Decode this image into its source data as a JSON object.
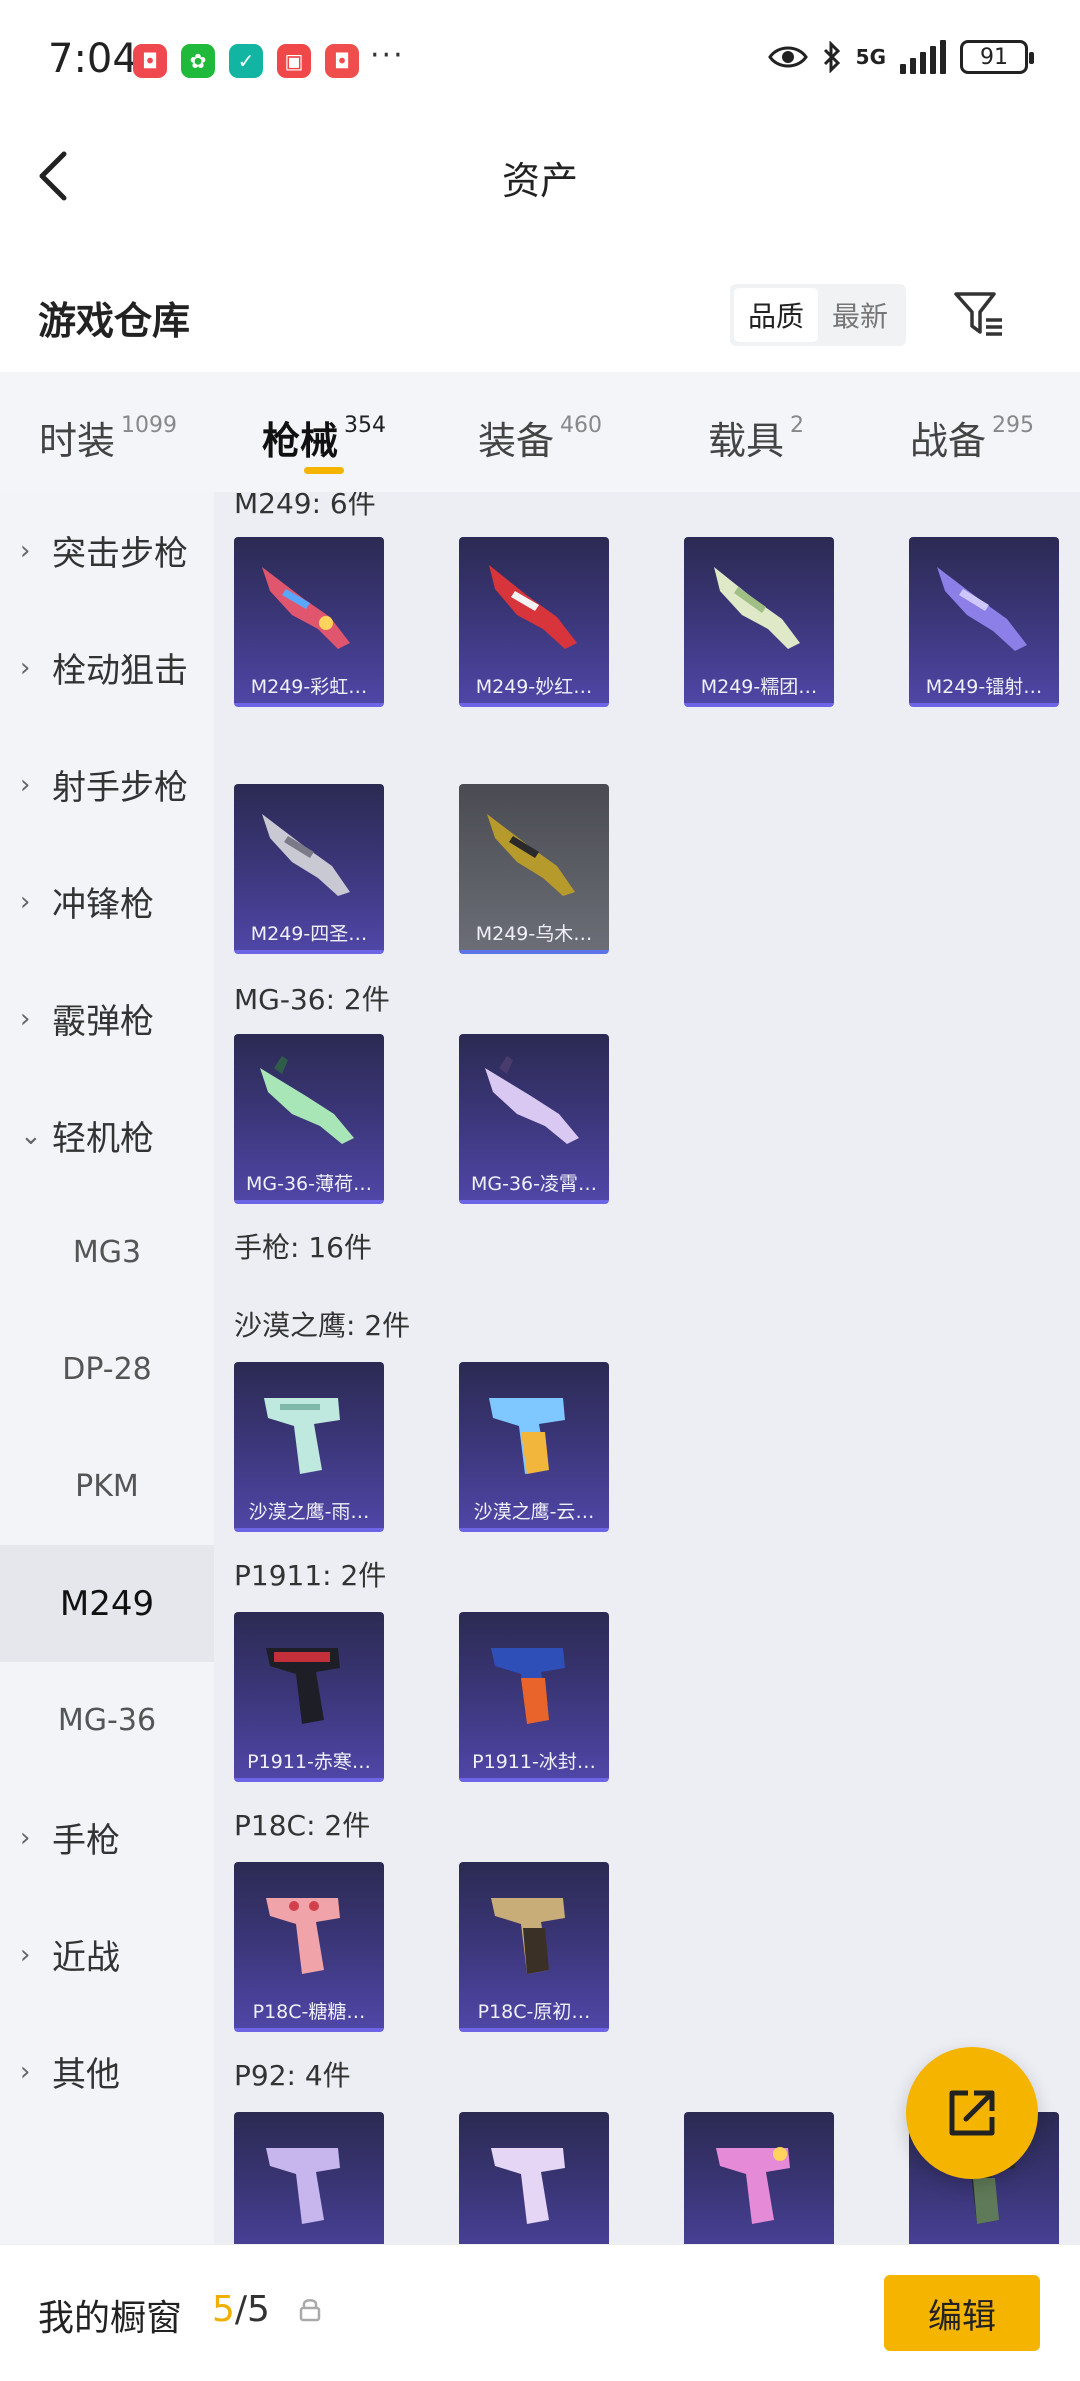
{
  "status_bar": {
    "time": "7:04",
    "more": "···",
    "network": "5G",
    "battery": "91",
    "app_icons": [
      {
        "name": "shop-app-icon",
        "color": "#f0484f",
        "glyph": "◘"
      },
      {
        "name": "wechat-app-icon",
        "color": "#1fb93c",
        "glyph": "✿"
      },
      {
        "name": "security-app-icon",
        "color": "#12b5a2",
        "glyph": "✓"
      },
      {
        "name": "gift-app-icon",
        "color": "#f04848",
        "glyph": "▣"
      },
      {
        "name": "store-app-icon",
        "color": "#f04d4d",
        "glyph": "◘"
      }
    ]
  },
  "header": {
    "title": "资产"
  },
  "section": {
    "title": "游戏仓库",
    "sort_quality": "品质",
    "sort_latest": "最新"
  },
  "tabs": [
    {
      "label": "时装",
      "count": "1099"
    },
    {
      "label": "枪械",
      "count": "354",
      "active": true
    },
    {
      "label": "装备",
      "count": "460"
    },
    {
      "label": "载具",
      "count": "2"
    },
    {
      "label": "战备",
      "count": "295"
    }
  ],
  "sidebar": {
    "categories": [
      {
        "label": "突击步枪",
        "chevron": "›"
      },
      {
        "label": "栓动狙击",
        "chevron": "›"
      },
      {
        "label": "射手步枪",
        "chevron": "›"
      },
      {
        "label": "冲锋枪",
        "chevron": "›"
      },
      {
        "label": "霰弹枪",
        "chevron": "›"
      },
      {
        "label": "轻机枪",
        "chevron": "⌄"
      }
    ],
    "subitems": [
      {
        "label": "MG3"
      },
      {
        "label": "DP-28"
      },
      {
        "label": "PKM"
      },
      {
        "label": "M249",
        "active": true
      },
      {
        "label": "MG-36"
      }
    ],
    "more_categories": [
      {
        "label": "手枪",
        "chevron": "›"
      },
      {
        "label": "近战",
        "chevron": "›"
      },
      {
        "label": "其他",
        "chevron": "›"
      }
    ]
  },
  "groups": {
    "m249": "M249: 6件",
    "mg36": "MG-36: 2件",
    "pistol": "手枪: 16件",
    "deagle": "沙漠之鹰: 2件",
    "p1911": "P1911: 2件",
    "p18c": "P18C: 2件",
    "p92": "P92: 4件"
  },
  "items": {
    "m249": [
      "M249-彩虹…",
      "M249-妙红…",
      "M249-糯团…",
      "M249-镭射…",
      "M249-四圣…",
      "M249-乌木…"
    ],
    "mg36": [
      "MG-36-薄荷…",
      "MG-36-凌霄…"
    ],
    "deagle": [
      "沙漠之鹰-雨…",
      "沙漠之鹰-云…"
    ],
    "p1911": [
      "P1911-赤寒…",
      "P1911-冰封…"
    ],
    "p18c": [
      "P18C-糖糖…",
      "P18C-原初…"
    ]
  },
  "showcase": {
    "label": "我的橱窗",
    "current": "5",
    "sep_total": "/5",
    "edit_label": "编辑"
  },
  "colors": {
    "accent": "#f5b400",
    "card_purple": "#3a3576",
    "card_gray": "#5e6068",
    "sidebar_bg": "#f2f4f8",
    "grid_bg": "#eceef3"
  }
}
